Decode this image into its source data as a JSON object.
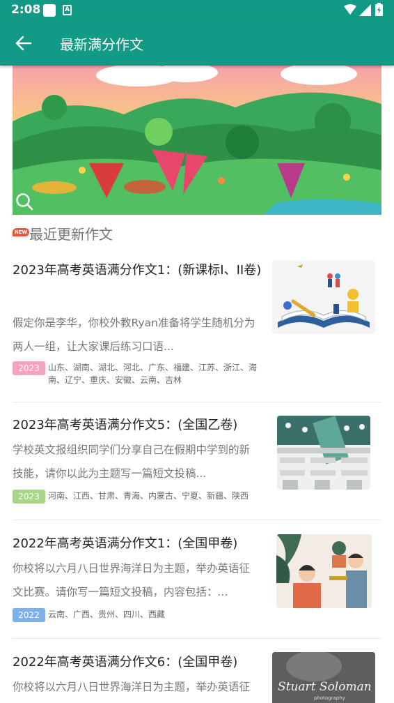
{
  "status_bar": {
    "time": "2:08",
    "app_icon_letter": "A",
    "icons": [
      "square-notification-icon",
      "a-notification-icon",
      "wifi-icon",
      "signal-icon",
      "battery-icon"
    ]
  },
  "app_bar": {
    "title": "最新满分作文",
    "back_icon": "arrow-back-icon"
  },
  "banner": {
    "icons": [
      "zoom-icon"
    ]
  },
  "section": {
    "badge": "NEW",
    "title": "最近更新作文"
  },
  "articles": [
    {
      "title": "2023年高考英语满分作文1：(新课标I、II卷)",
      "summary": "假定你是李华，你校外教Ryan准备将学生随机分为两人一组，让大家课后练习口语...",
      "year": "2023",
      "tag_color": "#f4a3bc",
      "regions": "山东、湖南、湖北、河北、广东、福建、江苏、浙江、海南、辽宁、重庆、安徽、云南、吉林"
    },
    {
      "title": "2023年高考英语满分作文5：(全国乙卷)",
      "summary": "学校英文报组织同学们分享自己在假期中学到的新技能，请你以此为主题写一篇短文投稿...",
      "year": "2023",
      "tag_color": "#a9d58a",
      "regions": "河南、江西、甘肃、青海、内蒙古、宁夏、新疆、陕西"
    },
    {
      "title": "2022年高考英语满分作文1：(全国甲卷)",
      "summary": "你校将以六月八日世界海洋日为主题，举办英语征文比赛。请你写一篇短文投稿，内容包括：...",
      "year": "2022",
      "tag_color": "#7fb1e8",
      "regions": "云南、广西、贵州、四川、西藏"
    },
    {
      "title": "2022年高考英语满分作文6：(全国甲卷)",
      "summary": "你校将以六月八日世界海洋日为主题，举办英语征",
      "thumb_text": "Stuart Soloman",
      "thumb_subtext": "photography"
    }
  ],
  "colors": {
    "primary": "#119a85",
    "new_badge": "#f0543f"
  }
}
